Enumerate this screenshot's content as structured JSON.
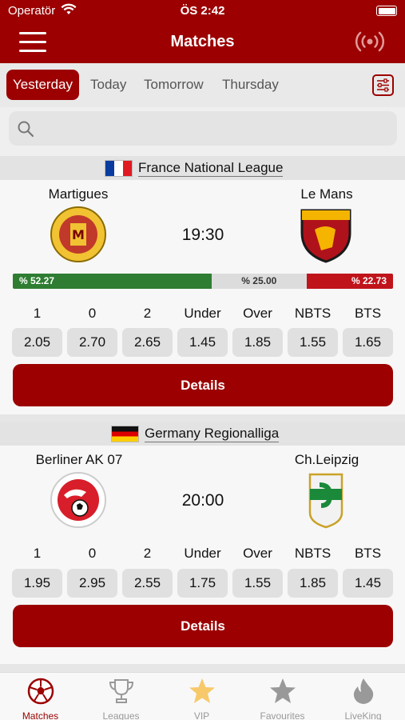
{
  "status_bar": {
    "carrier": "Operatör",
    "time": "ÖS 2:42"
  },
  "nav": {
    "title": "Matches"
  },
  "day_tabs": [
    "Yesterday",
    "Today",
    "Tomorrow",
    "Thursday"
  ],
  "search": {
    "placeholder": ""
  },
  "odds_labels": [
    "1",
    "0",
    "2",
    "Under",
    "Over",
    "NBTS",
    "BTS"
  ],
  "details_label": "Details",
  "matches": [
    {
      "league": "France National League",
      "home": "Martigues",
      "away": "Le Mans",
      "time": "19:30",
      "prob_home": "% 52.27",
      "prob_draw": "% 25.00",
      "prob_away": "% 22.73",
      "prob_values": [
        52.27,
        25.0,
        22.73
      ],
      "odds": [
        "2.05",
        "2.70",
        "2.65",
        "1.45",
        "1.85",
        "1.55",
        "1.65"
      ]
    },
    {
      "league": "Germany Regionalliga",
      "home": "Berliner AK 07",
      "away": "Ch.Leipzig",
      "time": "20:00",
      "odds": [
        "1.95",
        "2.95",
        "2.55",
        "1.75",
        "1.55",
        "1.85",
        "1.45"
      ]
    }
  ],
  "bottom_tabs": [
    "Matches",
    "Leagues",
    "VIP",
    "Favourites",
    "LiveKing"
  ],
  "colors": {
    "brand": "#9c0000",
    "home": "#2e7d32",
    "away": "#c0141b"
  }
}
